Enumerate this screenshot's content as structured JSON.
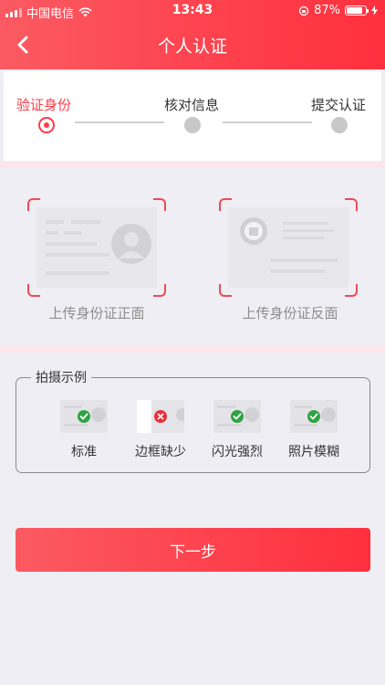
{
  "status_bar": {
    "carrier": "中国电信",
    "time": "13:43",
    "battery": "87%"
  },
  "nav": {
    "title": "个人认证"
  },
  "steps": [
    {
      "label": "验证身份",
      "active": true
    },
    {
      "label": "核对信息",
      "active": false
    },
    {
      "label": "提交认证",
      "active": false
    }
  ],
  "upload": {
    "front_label": "上传身份证正面",
    "back_label": "上传身份证反面"
  },
  "examples": {
    "title": "拍摄示例",
    "items": [
      {
        "label": "标准",
        "status": "ok"
      },
      {
        "label": "边框缺少",
        "status": "error"
      },
      {
        "label": "闪光强烈",
        "status": "ok"
      },
      {
        "label": "照片模糊",
        "status": "ok"
      }
    ]
  },
  "next_button": {
    "label": "下一步"
  },
  "colors": {
    "accent": "#ff3b46",
    "success": "#2ea344",
    "error": "#e8303d",
    "background": "#efeef4"
  }
}
